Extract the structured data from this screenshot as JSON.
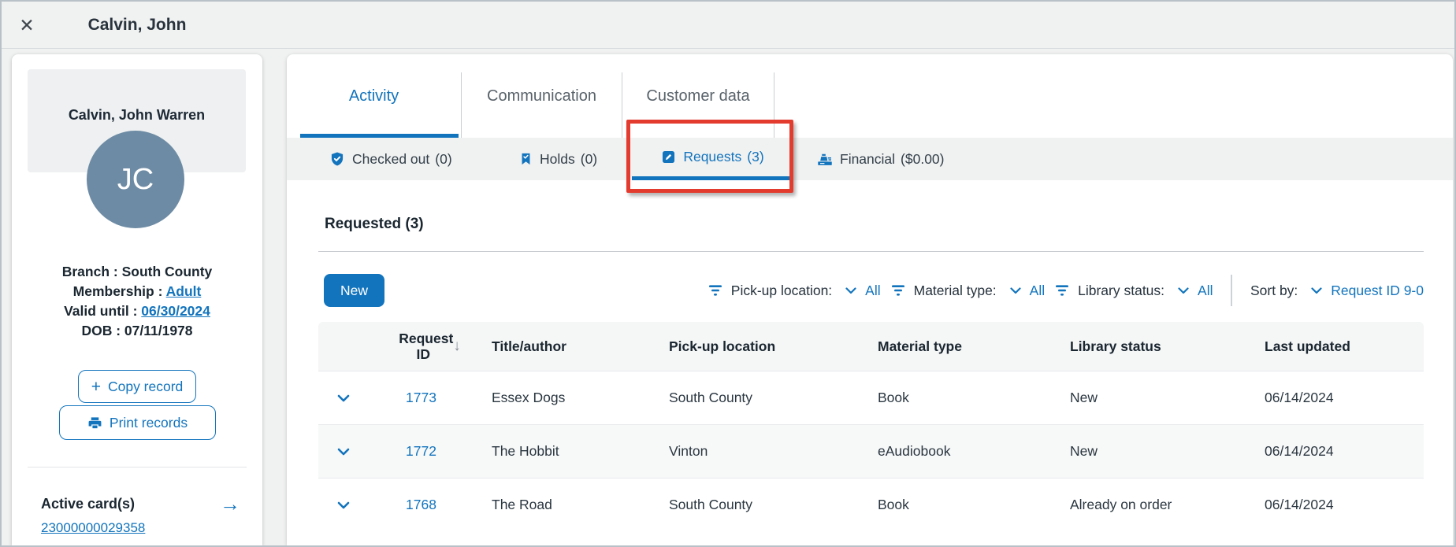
{
  "header": {
    "title": "Calvin, John"
  },
  "icons": {
    "close": "✕",
    "plus": "+",
    "arrow_right": "→",
    "sort_desc": "↓"
  },
  "colors": {
    "accent_blue": "#1274bd",
    "highlight_red": "#e33b2e",
    "avatar_bg": "#6d8ba4"
  },
  "sidebar": {
    "full_name": "Calvin, John Warren",
    "avatar_initials": "JC",
    "details": [
      {
        "label": "Branch : ",
        "value": "South County"
      },
      {
        "label": "Membership : ",
        "value": "Adult"
      },
      {
        "label": "Valid until : ",
        "value": "06/30/2024"
      },
      {
        "label": "DOB : ",
        "value": "07/11/1978"
      }
    ],
    "buttons": {
      "copy": "Copy record",
      "print": "Print records"
    },
    "active_cards": {
      "label": "Active card(s)",
      "card_number": "23000000029358"
    }
  },
  "tabs": [
    {
      "label": "Activity",
      "active": true
    },
    {
      "label": "Communication",
      "active": false
    },
    {
      "label": "Customer data",
      "active": false
    }
  ],
  "subtabs": [
    {
      "label": "Checked out",
      "count": "(0)",
      "icon": "shield-check"
    },
    {
      "label": "Holds",
      "count": "(0)",
      "icon": "bookmark-check"
    },
    {
      "label": "Requests",
      "count": "(3)",
      "icon": "edit-note",
      "active": true,
      "highlighted": true
    },
    {
      "label": "Financial",
      "count": "($0.00)",
      "icon": "cash-register"
    }
  ],
  "content": {
    "section_title": "Requested (3)",
    "new_button": "New",
    "filters": [
      {
        "label": "Pick-up location:",
        "value": "All"
      },
      {
        "label": "Material type:",
        "value": "All"
      },
      {
        "label": "Library status:",
        "value": "All"
      }
    ],
    "sort": {
      "label": "Sort by:",
      "value": "Request ID 9-0"
    },
    "table": {
      "columns": {
        "request_id": "Request ID",
        "title": "Title/author",
        "pickup": "Pick-up location",
        "material": "Material type",
        "status": "Library status",
        "updated": "Last updated"
      },
      "rows": [
        {
          "id": "1773",
          "title": "Essex Dogs",
          "pickup": "South County",
          "material": "Book",
          "status": "New",
          "updated": "06/14/2024"
        },
        {
          "id": "1772",
          "title": "The Hobbit",
          "pickup": "Vinton",
          "material": "eAudiobook",
          "status": "New",
          "updated": "06/14/2024"
        },
        {
          "id": "1768",
          "title": "The Road",
          "pickup": "South County",
          "material": "Book",
          "status": "Already on order",
          "updated": "06/14/2024"
        }
      ]
    }
  }
}
